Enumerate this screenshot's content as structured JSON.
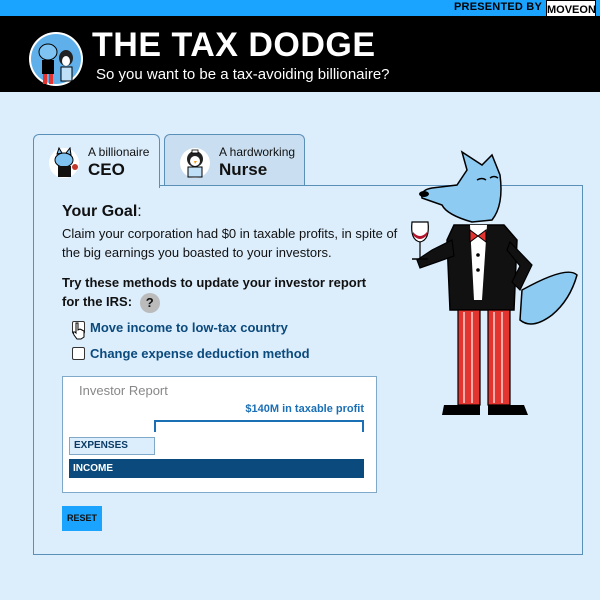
{
  "banner": {
    "presented_by": "PRESENTED BY",
    "logo_text": "MOVEON"
  },
  "header": {
    "title": "THE TAX DODGE",
    "subtitle": "So you want to be a tax-avoiding billionaire?"
  },
  "tabs": [
    {
      "small": "A billionaire",
      "big": "CEO",
      "active": true,
      "icon": "wolf-icon"
    },
    {
      "small": "A hardworking",
      "big": "Nurse",
      "active": false,
      "icon": "penguin-icon"
    }
  ],
  "goal": {
    "heading": "Your Goal",
    "colon": ":",
    "text": "Claim your corporation had $0 in taxable profits, in spite of the big earnings you boasted to your investors."
  },
  "methods": {
    "prompt": "Try these methods to update your investor report for the IRS:",
    "help": "?",
    "options": [
      {
        "label": "Move income to low-tax country",
        "checked": false
      },
      {
        "label": "Change expense deduction method",
        "checked": false
      }
    ]
  },
  "report": {
    "title": "Investor Report",
    "profit_label": "$140M in taxable profit",
    "expenses_label": "EXPENSES",
    "income_label": "INCOME"
  },
  "reset_label": "RESET",
  "colors": {
    "accent": "#1aa3ff",
    "income": "#0b4a7c",
    "profit_text": "#1a6fb5"
  }
}
